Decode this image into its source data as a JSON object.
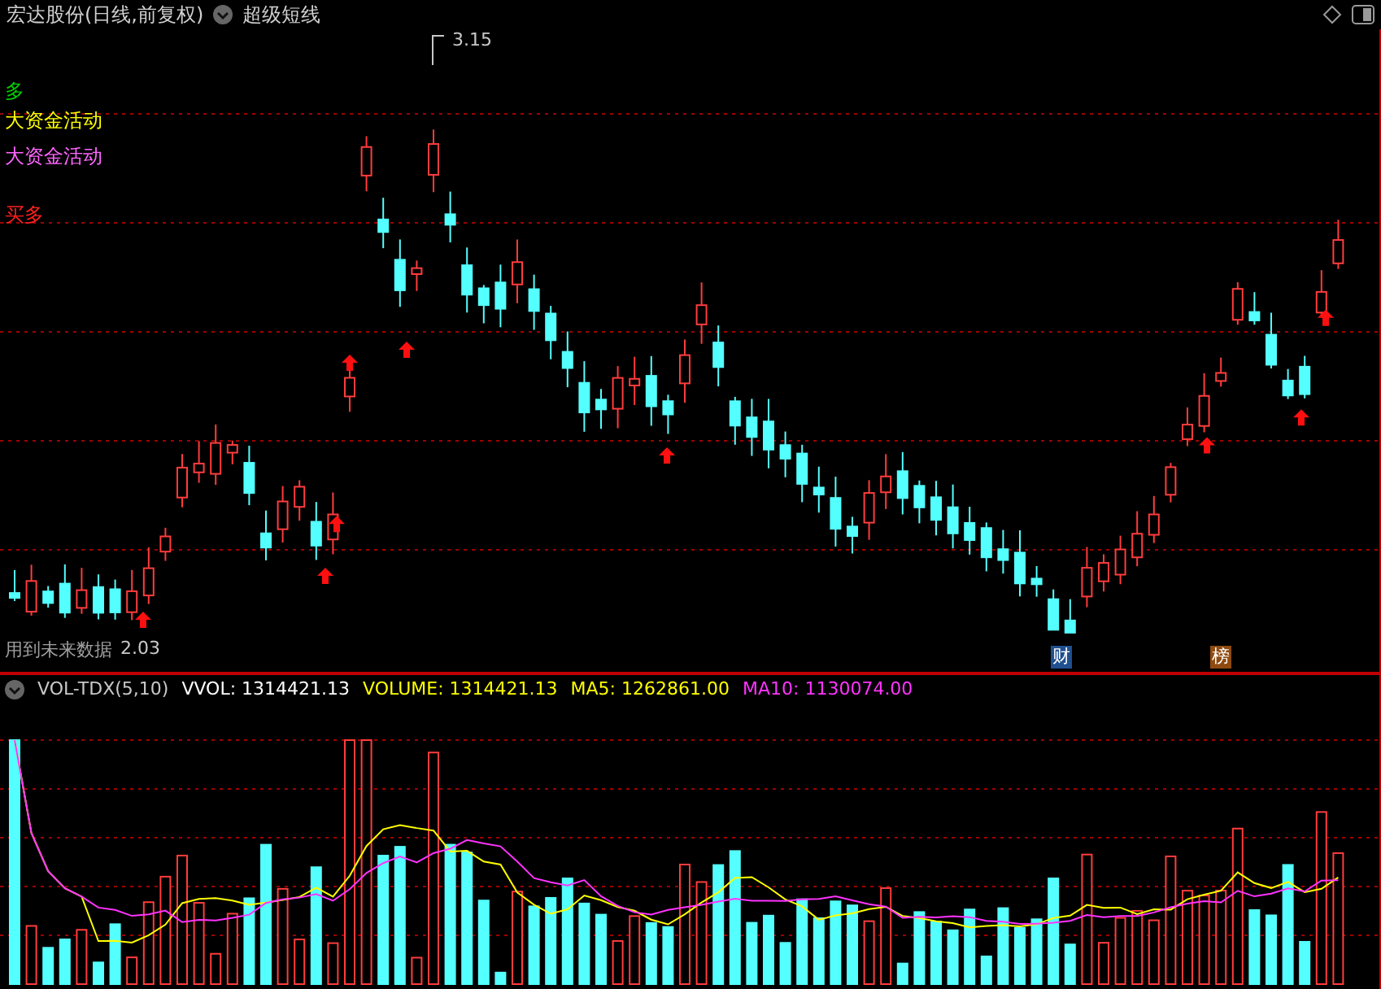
{
  "header": {
    "title": "宏达股份(日线,前复权)",
    "indicator": "超级短线"
  },
  "main_chart": {
    "signals": [
      {
        "label": "多",
        "color": "#00d000"
      },
      {
        "label": "大资金活动",
        "color": "#ffff00"
      },
      {
        "label": "大资金活动",
        "color": "#ff66ff"
      },
      {
        "label": "买多",
        "color": "#ff2020"
      }
    ],
    "high_label": "3.15",
    "low_label": "2.03",
    "warning": "用到未来数据",
    "badges": [
      {
        "label": "财",
        "color": "#1f4f8f"
      },
      {
        "label": "榜",
        "color": "#8f4a10"
      }
    ]
  },
  "volume_pane": {
    "legend": [
      {
        "label": "VOL-TDX(5,10)",
        "color": "#c8c8c8"
      },
      {
        "label": "VVOL: 1314421.13",
        "color": "#ffffff"
      },
      {
        "label": "VOLUME: 1314421.13",
        "color": "#ffff00"
      },
      {
        "label": "MA5: 1262861.00",
        "color": "#ffff00"
      },
      {
        "label": "MA10: 1130074.00",
        "color": "#ff33ff"
      }
    ]
  }
}
